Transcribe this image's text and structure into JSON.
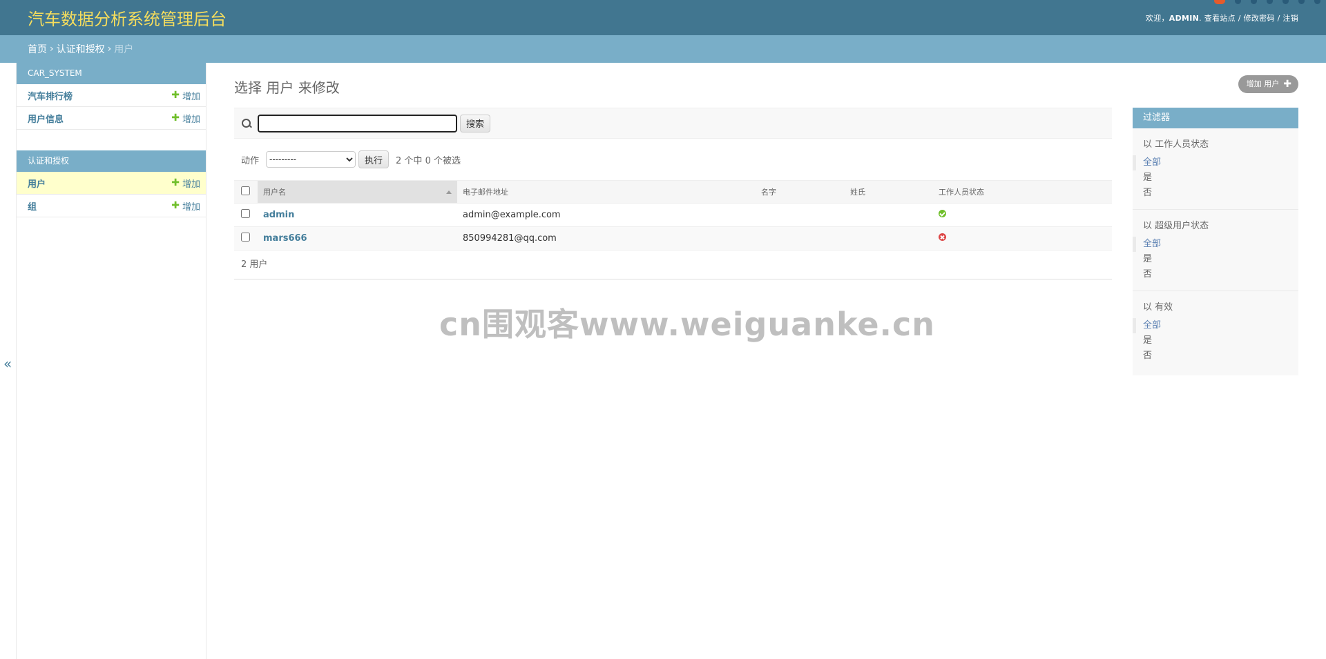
{
  "header": {
    "site_name": "汽车数据分析系统管理后台",
    "welcome": "欢迎，",
    "username": "ADMIN",
    "view_site": "查看站点",
    "change_password": "修改密码",
    "logout": "注销",
    "separator": "/"
  },
  "breadcrumbs": {
    "home": "首页",
    "app": "认证和授权",
    "current": "用户",
    "sep": "›"
  },
  "sidebar": {
    "modules": [
      {
        "caption": "CAR_SYSTEM",
        "rows": [
          {
            "label": "汽车排行榜",
            "add": "增加"
          },
          {
            "label": "用户信息",
            "add": "增加"
          }
        ]
      },
      {
        "caption": "认证和授权",
        "rows": [
          {
            "label": "用户",
            "add": "增加"
          },
          {
            "label": "组",
            "add": "增加"
          }
        ]
      }
    ],
    "toggle": "«"
  },
  "content": {
    "title": "选择 用户 来修改",
    "add_button": "增加 用户",
    "search": {
      "value": "",
      "button": "搜索"
    },
    "actions": {
      "label": "动作",
      "selected_option": "---------",
      "run": "执行",
      "counter": "2 个中 0 个被选"
    },
    "table": {
      "columns": [
        "用户名",
        "电子邮件地址",
        "名字",
        "姓氏",
        "工作人员状态"
      ],
      "rows": [
        {
          "username": "admin",
          "email": "admin@example.com",
          "first_name": "",
          "last_name": "",
          "is_staff": true
        },
        {
          "username": "mars666",
          "email": "850994281@qq.com",
          "first_name": "",
          "last_name": "",
          "is_staff": false
        }
      ]
    },
    "paginator": "2 用户"
  },
  "filter": {
    "title": "过滤器",
    "sections": [
      {
        "title": "以 工作人员状态",
        "options": [
          "全部",
          "是",
          "否"
        ]
      },
      {
        "title": "以 超级用户状态",
        "options": [
          "全部",
          "是",
          "否"
        ]
      },
      {
        "title": "以 有效",
        "options": [
          "全部",
          "是",
          "否"
        ]
      }
    ]
  },
  "watermark": "cn围观客www.weiguanke.cn",
  "colors": {
    "header_bg": "#417690",
    "site_name": "#f5dd5d",
    "breadcrumbs_bg": "#79aec8",
    "link": "#447e9b",
    "add_plus": "#70bf2b",
    "status_yes": "#70bf2b",
    "status_no": "#dd4646"
  }
}
